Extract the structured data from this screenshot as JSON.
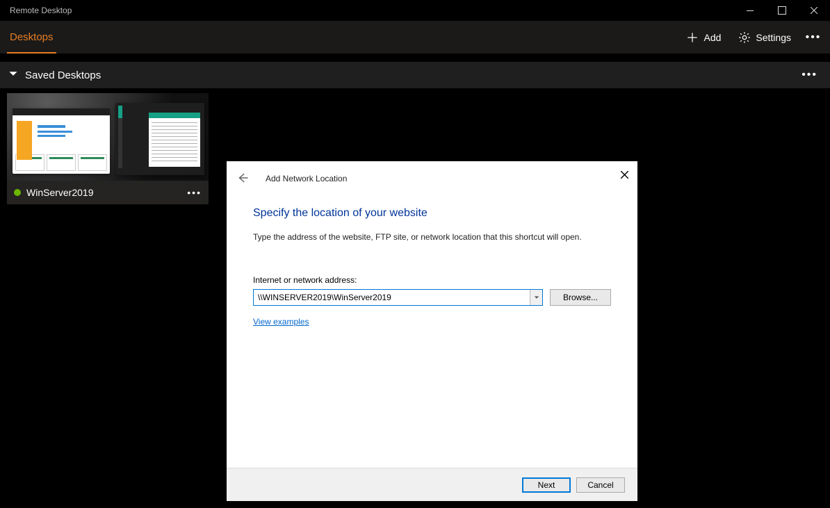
{
  "window": {
    "title": "Remote Desktop"
  },
  "tabs": {
    "active": "Desktops"
  },
  "toolbar": {
    "add_label": "Add",
    "settings_label": "Settings"
  },
  "section": {
    "title": "Saved Desktops"
  },
  "cards": [
    {
      "name": "WinServer2019",
      "status": "online"
    }
  ],
  "dialog": {
    "wizard_title": "Add Network Location",
    "heading": "Specify the location of your website",
    "description": "Type the address of the website, FTP site, or network location that this shortcut will open.",
    "field_label": "Internet or network address:",
    "address_value": "\\\\WINSERVER2019\\WinServer2019",
    "browse_label": "Browse...",
    "examples_link": "View examples",
    "next_label": "Next",
    "cancel_label": "Cancel"
  }
}
